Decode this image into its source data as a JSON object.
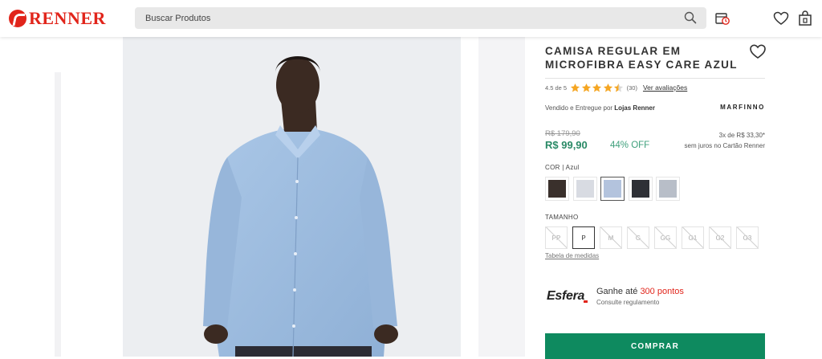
{
  "header": {
    "logo_text": "RENNER",
    "search_placeholder": "Buscar Produtos"
  },
  "product": {
    "title": "CAMISA REGULAR EM MICROFIBRA EASY CARE AZUL",
    "rating": {
      "score_text": "4.5 de 5",
      "value": 4.5,
      "max": 5,
      "count_text": "(30)",
      "link_text": "Ver avaliações",
      "star_color": "#f5a623"
    },
    "seller": {
      "prefix": "Vendido e Entregue por ",
      "name": "Lojas Renner"
    },
    "brand": "MARFINNO",
    "price": {
      "old": "R$ 179,90",
      "current": "R$ 99,90",
      "discount": "44% OFF",
      "installment_line1": "3x de R$ 33,30*",
      "installment_line2": "sem juros no Cartão Renner"
    },
    "color": {
      "label": "COR",
      "selected_name": "| Azul",
      "swatches": [
        {
          "color": "#3a302c",
          "selected": false
        },
        {
          "color": "#d8dbe2",
          "selected": false
        },
        {
          "color": "#b3c3dd",
          "selected": true
        },
        {
          "color": "#2e3036",
          "selected": false
        },
        {
          "color": "#b8bec8",
          "selected": false
        }
      ]
    },
    "size": {
      "label": "TAMANHO",
      "options": [
        {
          "label": "PP",
          "available": false,
          "selected": false
        },
        {
          "label": "P",
          "available": true,
          "selected": true
        },
        {
          "label": "M",
          "available": false,
          "selected": false
        },
        {
          "label": "G",
          "available": false,
          "selected": false
        },
        {
          "label": "GG",
          "available": false,
          "selected": false
        },
        {
          "label": "G1",
          "available": false,
          "selected": false
        },
        {
          "label": "G2",
          "available": false,
          "selected": false
        },
        {
          "label": "G3",
          "available": false,
          "selected": false
        }
      ],
      "table_link": "Tabela de medidas"
    },
    "esfera": {
      "logo": "Esfera",
      "text_prefix": "Ganhe até ",
      "points": "300 pontos",
      "sub": "Consulte regulamento"
    },
    "buy_label": "COMPRAR"
  },
  "colors": {
    "brand_red": "#e1251b",
    "price_green": "#2a8a66",
    "buy_green": "#0e8a5f"
  },
  "icons": [
    "search-icon",
    "store-pickup-icon",
    "heart-icon",
    "bag-icon",
    "favorite-heart-icon",
    "star-icon"
  ]
}
